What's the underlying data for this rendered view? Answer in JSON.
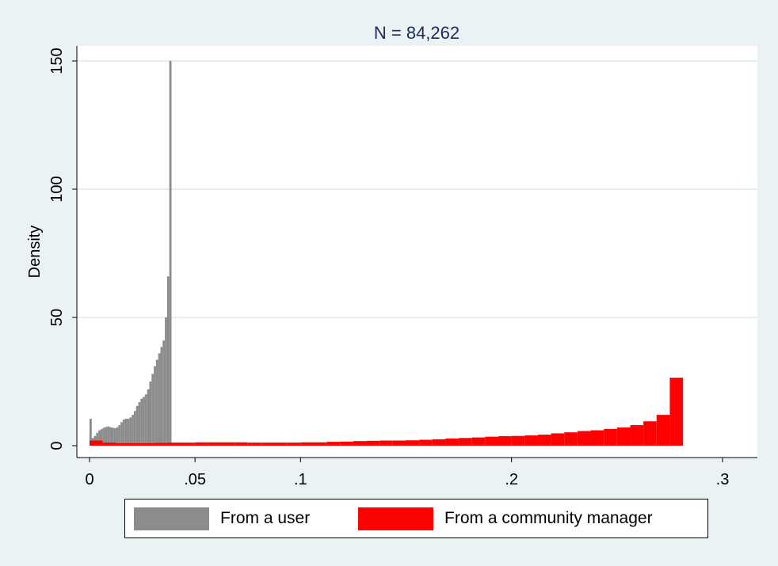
{
  "chart_data": {
    "type": "bar",
    "title": "N = 84,262",
    "xlabel": "",
    "ylabel": "Density",
    "xlim": [
      -0.001,
      0.3155
    ],
    "ylim": [
      0,
      150
    ],
    "x_ticks": [
      0,
      0.05,
      0.1,
      0.2,
      0.3
    ],
    "x_tick_labels": [
      "0",
      ".05",
      ".1",
      ".2",
      ".3"
    ],
    "y_ticks": [
      0,
      50,
      100,
      150
    ],
    "y_tick_labels": [
      "0",
      "50",
      "100",
      "150"
    ],
    "grid": true,
    "legend_position": "bottom",
    "series": [
      {
        "name": "From a user",
        "color": "#8c8c8c",
        "bin_width": 0.00105,
        "bin_start": 0,
        "values": [
          10.5,
          3.0,
          3.8,
          5.0,
          6.0,
          6.5,
          7.0,
          7.3,
          7.5,
          7.2,
          7.0,
          6.8,
          7.2,
          8.0,
          9.2,
          10.2,
          10.5,
          10.5,
          11.0,
          12.0,
          13.5,
          15.5,
          17.0,
          18.3,
          19.0,
          20.0,
          22.0,
          25.0,
          28.0,
          31.0,
          33.5,
          36.0,
          38.5,
          41.0,
          50.0,
          66.0,
          150.0
        ]
      },
      {
        "name": "From a community manager",
        "color": "#ff0000",
        "bin_width": 0.00625,
        "bin_start": 0,
        "values": [
          2.0,
          1.2,
          1.0,
          1.0,
          1.0,
          1.1,
          1.2,
          1.2,
          1.3,
          1.3,
          1.3,
          1.3,
          1.2,
          1.2,
          1.2,
          1.2,
          1.3,
          1.3,
          1.5,
          1.6,
          1.8,
          1.9,
          2.0,
          2.0,
          2.1,
          2.3,
          2.5,
          2.8,
          3.0,
          3.2,
          3.5,
          3.7,
          3.8,
          4.0,
          4.3,
          4.8,
          5.2,
          5.7,
          6.0,
          6.5,
          7.1,
          8.0,
          9.5,
          12.0,
          26.5
        ]
      }
    ]
  },
  "legend": {
    "items": [
      {
        "label": "From a user",
        "color": "#8c8c8c"
      },
      {
        "label": "From a community manager",
        "color": "#ff0000"
      }
    ]
  }
}
